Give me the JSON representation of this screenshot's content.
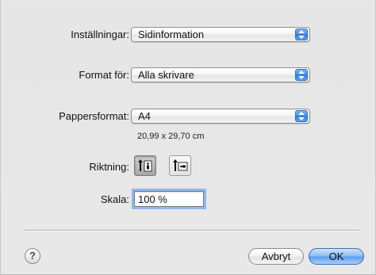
{
  "settings": {
    "label": "Inställningar:",
    "value": "Sidinformation"
  },
  "format_for": {
    "label": "Format för:",
    "value": "Alla skrivare"
  },
  "paper_size": {
    "label": "Pappersformat:",
    "value": "A4",
    "dimensions": "20,99 x 29,70 cm"
  },
  "orientation": {
    "label": "Riktning:",
    "options": [
      "portrait",
      "landscape"
    ],
    "selected": "portrait"
  },
  "scale": {
    "label": "Skala:",
    "value": "100 %"
  },
  "buttons": {
    "help": "?",
    "cancel": "Avbryt",
    "ok": "OK"
  }
}
